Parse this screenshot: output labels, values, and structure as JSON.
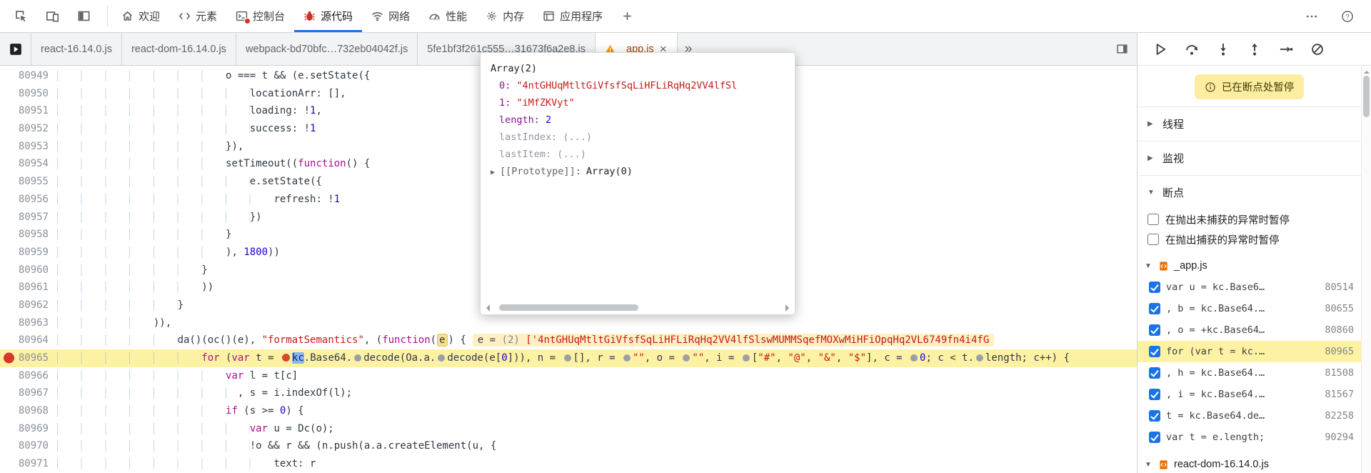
{
  "colors": {
    "accent": "#1a73e8",
    "exec_line": "#fdf2a4",
    "breakpoint_red": "#d7372a",
    "keyword": "#aa0d91",
    "string": "#c41a16",
    "number": "#1c00cf",
    "warning": "#f29900"
  },
  "top_toolbar": {
    "left_icons": [
      {
        "name": "inspect-icon"
      },
      {
        "name": "device-toolbar-icon"
      },
      {
        "name": "dock-side-icon"
      }
    ],
    "tabs": [
      {
        "id": "welcome",
        "label": "欢迎",
        "icon": "home-icon",
        "active": false
      },
      {
        "id": "elements",
        "label": "元素",
        "icon": "elements-icon",
        "active": false
      },
      {
        "id": "console",
        "label": "控制台",
        "icon": "console-icon",
        "active": false,
        "badge": true
      },
      {
        "id": "sources",
        "label": "源代码",
        "icon": "bug-icon",
        "active": true
      },
      {
        "id": "network",
        "label": "网络",
        "icon": "network-icon",
        "active": false
      },
      {
        "id": "performance",
        "label": "性能",
        "icon": "performance-icon",
        "active": false
      },
      {
        "id": "memory",
        "label": "内存",
        "icon": "memory-icon",
        "active": false
      },
      {
        "id": "application",
        "label": "应用程序",
        "icon": "application-icon",
        "active": false
      },
      {
        "id": "more-panels",
        "label": "",
        "icon": "plus-icon",
        "active": false
      }
    ],
    "right_icons": [
      {
        "name": "more-menu-icon"
      },
      {
        "name": "help-icon"
      }
    ]
  },
  "file_tabs": {
    "left_icon": "navigator-toggle-icon",
    "tabs": [
      {
        "label": "react-16.14.0.js",
        "active": false
      },
      {
        "label": "react-dom-16.14.0.js",
        "active": false
      },
      {
        "label": "webpack-bd70bfc…732eb04042f.js",
        "active": false
      },
      {
        "label": "5fe1bf3f261c555…31673f6a2e8.js",
        "active": false
      },
      {
        "label": "_app.js",
        "active": true,
        "warning": true,
        "closable": true
      }
    ],
    "overflow_icon": "chevrons-right-icon",
    "right_icon": "toggle-panel-icon"
  },
  "editor": {
    "lines": [
      {
        "num": "80949",
        "indent": 28,
        "tokens": [
          [
            "p",
            "o === t && (e.setState({"
          ]
        ]
      },
      {
        "num": "80950",
        "indent": 32,
        "tokens": [
          [
            "p",
            "locationArr: [],"
          ]
        ]
      },
      {
        "num": "80951",
        "indent": 32,
        "tokens": [
          [
            "p",
            "loading: !"
          ],
          [
            "n",
            "1"
          ],
          [
            "p",
            ","
          ]
        ]
      },
      {
        "num": "80952",
        "indent": 32,
        "tokens": [
          [
            "p",
            "success: !"
          ],
          [
            "n",
            "1"
          ]
        ]
      },
      {
        "num": "80953",
        "indent": 28,
        "tokens": [
          [
            "p",
            "}),"
          ]
        ]
      },
      {
        "num": "80954",
        "indent": 28,
        "tokens": [
          [
            "p",
            "setTimeout(("
          ],
          [
            "k",
            "function"
          ],
          [
            "p",
            "() {"
          ]
        ]
      },
      {
        "num": "80955",
        "indent": 32,
        "tokens": [
          [
            "p",
            "e.setState({"
          ]
        ]
      },
      {
        "num": "80956",
        "indent": 36,
        "tokens": [
          [
            "p",
            "refresh: !"
          ],
          [
            "n",
            "1"
          ]
        ]
      },
      {
        "num": "80957",
        "indent": 32,
        "tokens": [
          [
            "p",
            "})"
          ]
        ]
      },
      {
        "num": "80958",
        "indent": 28,
        "tokens": [
          [
            "p",
            "}"
          ]
        ]
      },
      {
        "num": "80959",
        "indent": 28,
        "tokens": [
          [
            "p",
            "), "
          ],
          [
            "n",
            "1800"
          ],
          [
            "p",
            "))"
          ]
        ]
      },
      {
        "num": "80960",
        "indent": 24,
        "tokens": [
          [
            "p",
            "}"
          ]
        ]
      },
      {
        "num": "80961",
        "indent": 24,
        "tokens": [
          [
            "p",
            "))"
          ]
        ]
      },
      {
        "num": "80962",
        "indent": 20,
        "tokens": [
          [
            "p",
            "}"
          ]
        ]
      },
      {
        "num": "80963",
        "indent": 16,
        "tokens": [
          [
            "p",
            ")),"
          ]
        ]
      },
      {
        "num": "80964",
        "indent": 20,
        "tokens": [
          [
            "p",
            "da()(oc()(e), "
          ],
          [
            "s",
            "\"formatSemantics\""
          ],
          [
            "p",
            ", ("
          ],
          [
            "k",
            "function"
          ],
          [
            "p",
            "("
          ],
          [
            "prm",
            "e"
          ],
          [
            "p",
            ") {"
          ]
        ],
        "eval": [
          [
            "ev",
            "e = "
          ],
          [
            "dim",
            "(2) "
          ],
          [
            "s",
            "['4ntGHUqMtltGiVfsfSqLiHFLiRqHq2VV4lfSlswMUMMSqefMOXwMiHFiOpqHq2VL6749fn4i4fG"
          ]
        ]
      },
      {
        "num": "80965",
        "indent": 24,
        "exec": true,
        "gutter_breakpoint": true,
        "tokens": [
          [
            "k",
            "for"
          ],
          [
            "p",
            " ("
          ],
          [
            "k",
            "var"
          ],
          [
            "p",
            " t = "
          ],
          [
            "mkr"
          ],
          [
            "sel",
            "kc"
          ],
          [
            "p",
            ".Base64."
          ],
          [
            "mk"
          ],
          [
            "p",
            "decode(Oa.a."
          ],
          [
            "mk"
          ],
          [
            "p",
            "decode(e["
          ],
          [
            "n",
            "0"
          ],
          [
            "p",
            "])), n = "
          ],
          [
            "mk"
          ],
          [
            "p",
            "[], r = "
          ],
          [
            "mk"
          ],
          [
            "s",
            "\"\""
          ],
          [
            "p",
            ", o = "
          ],
          [
            "mk"
          ],
          [
            "s",
            "\"\""
          ],
          [
            "p",
            ", i = "
          ],
          [
            "mk"
          ],
          [
            "p",
            "["
          ],
          [
            "s",
            "\"#\""
          ],
          [
            "p",
            ", "
          ],
          [
            "s",
            "\"@\""
          ],
          [
            "p",
            ", "
          ],
          [
            "s",
            "\"&\""
          ],
          [
            "p",
            ", "
          ],
          [
            "s",
            "\"$\""
          ],
          [
            "p",
            "], c = "
          ],
          [
            "mk"
          ],
          [
            "n",
            "0"
          ],
          [
            "p",
            "; c < t."
          ],
          [
            "mk"
          ],
          [
            "p",
            "length; c++) {"
          ]
        ]
      },
      {
        "num": "80966",
        "indent": 28,
        "tokens": [
          [
            "k",
            "var"
          ],
          [
            "p",
            " l = t[c]"
          ]
        ]
      },
      {
        "num": "80967",
        "indent": 30,
        "tokens": [
          [
            "p",
            ", s = i.indexOf(l);"
          ]
        ]
      },
      {
        "num": "80968",
        "indent": 28,
        "tokens": [
          [
            "k",
            "if"
          ],
          [
            "p",
            " (s >= "
          ],
          [
            "n",
            "0"
          ],
          [
            "p",
            ") {"
          ]
        ]
      },
      {
        "num": "80969",
        "indent": 32,
        "tokens": [
          [
            "k",
            "var"
          ],
          [
            "p",
            " u = Dc(o);"
          ]
        ]
      },
      {
        "num": "80970",
        "indent": 32,
        "tokens": [
          [
            "p",
            "!o && r && (n.push(a.a.createElement(u, {"
          ]
        ]
      },
      {
        "num": "80971",
        "indent": 36,
        "tokens": [
          [
            "p",
            "text: r"
          ]
        ]
      }
    ]
  },
  "popup": {
    "header": "Array(2)",
    "rows": [
      {
        "key": "0",
        "key_style": "index",
        "value": "\"4ntGHUqMtltGiVfsfSqLiHFLiRqHq2VV4lfSl",
        "value_style": "string"
      },
      {
        "key": "1",
        "key_style": "index",
        "value": "\"iMfZKVyt\"",
        "value_style": "string"
      },
      {
        "key": "length",
        "key_style": "index",
        "value": "2",
        "value_style": "number"
      },
      {
        "key": "lastIndex",
        "key_style": "dim",
        "value": "(...)",
        "value_style": "dim"
      },
      {
        "key": "lastItem",
        "key_style": "dim",
        "value": "(...)",
        "value_style": "dim"
      }
    ],
    "prototype_row": {
      "label": "[[Prototype]]:",
      "value": "Array(0)"
    }
  },
  "debugger": {
    "toolbar_icons": [
      {
        "name": "resume-icon"
      },
      {
        "name": "step-over-icon"
      },
      {
        "name": "step-into-icon"
      },
      {
        "name": "step-out-icon"
      },
      {
        "name": "step-icon"
      },
      {
        "name": "deactivate-breakpoints-icon"
      }
    ],
    "paused_banner": "已在断点处暂停",
    "sections": {
      "threads": "线程",
      "watch": "监视",
      "breakpoints": "断点"
    },
    "pause_options": [
      {
        "label": "在抛出未捕获的异常时暂停",
        "checked": false
      },
      {
        "label": "在抛出捕获的异常时暂停",
        "checked": false
      }
    ],
    "breakpoint_groups": [
      {
        "file": "_app.js",
        "entries": [
          {
            "code": "var u = kc.Base6…",
            "line": "80514",
            "checked": true
          },
          {
            "code": ", b = kc.Base64.…",
            "line": "80655",
            "checked": true
          },
          {
            "code": ", o = +kc.Base64…",
            "line": "80860",
            "checked": true
          },
          {
            "code": "for (var t = kc.…",
            "line": "80965",
            "checked": true,
            "highlighted": true
          },
          {
            "code": ", h = kc.Base64.…",
            "line": "81508",
            "checked": true
          },
          {
            "code": ", i = kc.Base64.…",
            "line": "81567",
            "checked": true
          },
          {
            "code": "t = kc.Base64.de…",
            "line": "82258",
            "checked": true
          },
          {
            "code": "var t = e.length;",
            "line": "90294",
            "checked": true
          }
        ]
      },
      {
        "file": "react-dom-16.14.0.js",
        "entries": []
      }
    ]
  }
}
